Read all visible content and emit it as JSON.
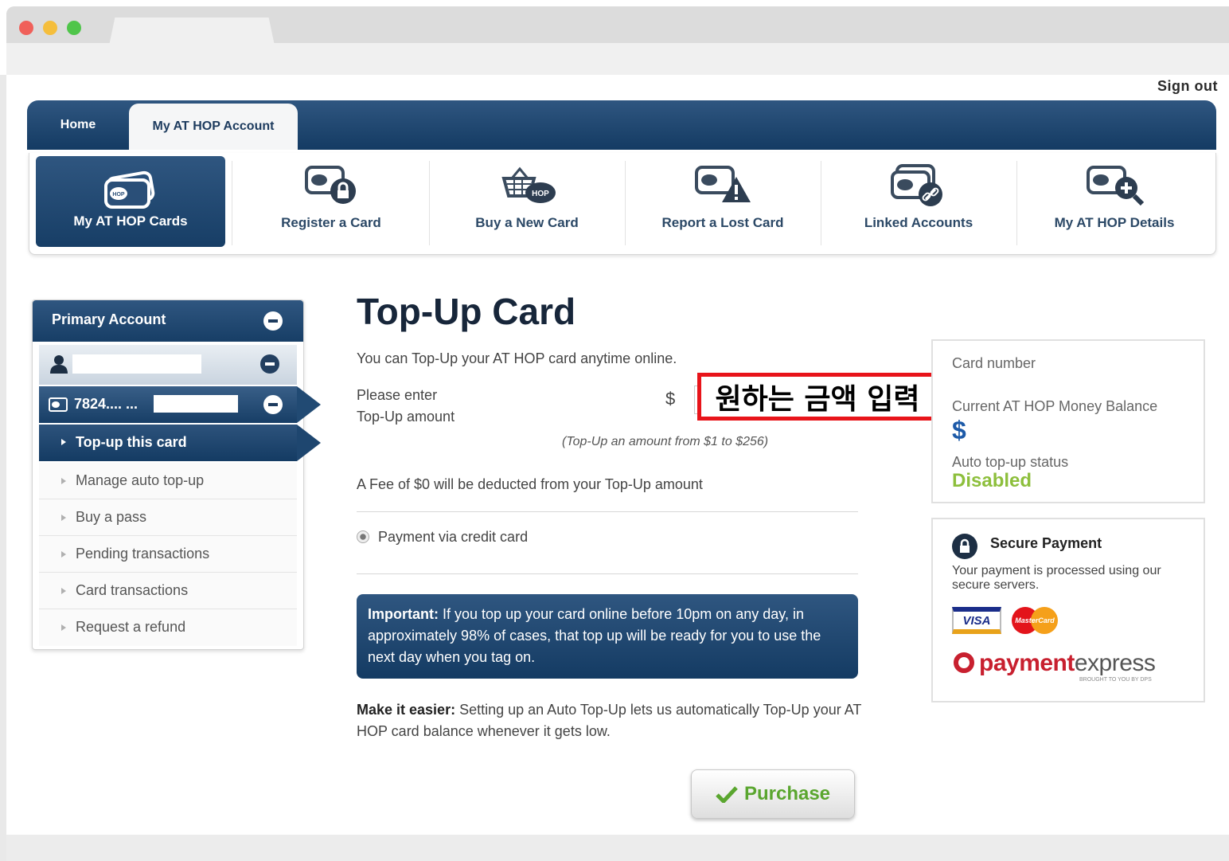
{
  "header": {
    "sign_out": "Sign out"
  },
  "main_nav": {
    "home": "Home",
    "my_account": "My AT HOP Account"
  },
  "icon_nav": [
    {
      "label": "My AT HOP Cards",
      "icon": "hop-card-icon"
    },
    {
      "label": "Register a Card",
      "icon": "hop-card-lock-icon"
    },
    {
      "label": "Buy a New Card",
      "icon": "basket-hop-icon"
    },
    {
      "label": "Report a Lost Card",
      "icon": "hop-card-warning-icon"
    },
    {
      "label": "Linked Accounts",
      "icon": "hop-card-link-icon"
    },
    {
      "label": "My AT HOP Details",
      "icon": "hop-card-magnify-icon"
    }
  ],
  "sidebar": {
    "header": "Primary Account",
    "card_number": "7824.... ...",
    "active_item": "Top-up this card",
    "items": [
      "Manage auto top-up",
      "Buy a pass",
      "Pending transactions",
      "Card transactions",
      "Request a refund"
    ]
  },
  "main": {
    "title": "Top-Up Card",
    "intro": "You can Top-Up your AT HOP card anytime online.",
    "enter_label_1": "Please enter",
    "enter_label_2": "Top-Up amount",
    "currency": "$",
    "annotation": "원하는 금액 입력",
    "hint": "(Top-Up an amount from $1 to $256)",
    "fee": "A Fee of $0 will be deducted from your Top-Up amount",
    "payment_option": "Payment via credit card",
    "important_label": "Important:",
    "important_text": "If you top up your card online before 10pm on any day, in approximately 98% of cases, that top up will be ready for you to use the next day when you tag on.",
    "easier_label": "Make it easier:",
    "easier_text": "Setting up an Auto Top-Up lets us automatically Top-Up your AT HOP card balance whenever it gets low.",
    "purchase": "Purchase"
  },
  "card_info": {
    "card_number_label": "Card number",
    "balance_label": "Current AT HOP Money Balance",
    "balance_currency": "$",
    "auto_topup_label": "Auto top-up status",
    "auto_topup_status": "Disabled"
  },
  "secure": {
    "title": "Secure Payment",
    "text": "Your payment is processed using our secure servers.",
    "visa": "VISA",
    "mastercard": "MasterCard",
    "brand_a": "payment",
    "brand_b": "express",
    "brand_tagline": "BROUGHT TO YOU BY DPS"
  },
  "colors": {
    "nav_dark": "#173e66",
    "accent_green": "#8dbf3c",
    "annotation_red": "#e8141a"
  }
}
